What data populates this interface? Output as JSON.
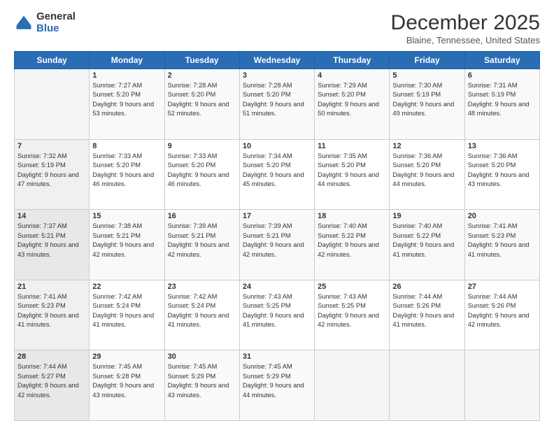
{
  "logo": {
    "general": "General",
    "blue": "Blue"
  },
  "title": "December 2025",
  "subtitle": "Blaine, Tennessee, United States",
  "days_header": [
    "Sunday",
    "Monday",
    "Tuesday",
    "Wednesday",
    "Thursday",
    "Friday",
    "Saturday"
  ],
  "weeks": [
    [
      {
        "day": "",
        "sunrise": "",
        "sunset": "",
        "daylight": ""
      },
      {
        "day": "1",
        "sunrise": "Sunrise: 7:27 AM",
        "sunset": "Sunset: 5:20 PM",
        "daylight": "Daylight: 9 hours and 53 minutes."
      },
      {
        "day": "2",
        "sunrise": "Sunrise: 7:28 AM",
        "sunset": "Sunset: 5:20 PM",
        "daylight": "Daylight: 9 hours and 52 minutes."
      },
      {
        "day": "3",
        "sunrise": "Sunrise: 7:28 AM",
        "sunset": "Sunset: 5:20 PM",
        "daylight": "Daylight: 9 hours and 51 minutes."
      },
      {
        "day": "4",
        "sunrise": "Sunrise: 7:29 AM",
        "sunset": "Sunset: 5:20 PM",
        "daylight": "Daylight: 9 hours and 50 minutes."
      },
      {
        "day": "5",
        "sunrise": "Sunrise: 7:30 AM",
        "sunset": "Sunset: 5:19 PM",
        "daylight": "Daylight: 9 hours and 49 minutes."
      },
      {
        "day": "6",
        "sunrise": "Sunrise: 7:31 AM",
        "sunset": "Sunset: 5:19 PM",
        "daylight": "Daylight: 9 hours and 48 minutes."
      }
    ],
    [
      {
        "day": "7",
        "sunrise": "Sunrise: 7:32 AM",
        "sunset": "Sunset: 5:19 PM",
        "daylight": "Daylight: 9 hours and 47 minutes."
      },
      {
        "day": "8",
        "sunrise": "Sunrise: 7:33 AM",
        "sunset": "Sunset: 5:20 PM",
        "daylight": "Daylight: 9 hours and 46 minutes."
      },
      {
        "day": "9",
        "sunrise": "Sunrise: 7:33 AM",
        "sunset": "Sunset: 5:20 PM",
        "daylight": "Daylight: 9 hours and 46 minutes."
      },
      {
        "day": "10",
        "sunrise": "Sunrise: 7:34 AM",
        "sunset": "Sunset: 5:20 PM",
        "daylight": "Daylight: 9 hours and 45 minutes."
      },
      {
        "day": "11",
        "sunrise": "Sunrise: 7:35 AM",
        "sunset": "Sunset: 5:20 PM",
        "daylight": "Daylight: 9 hours and 44 minutes."
      },
      {
        "day": "12",
        "sunrise": "Sunrise: 7:36 AM",
        "sunset": "Sunset: 5:20 PM",
        "daylight": "Daylight: 9 hours and 44 minutes."
      },
      {
        "day": "13",
        "sunrise": "Sunrise: 7:36 AM",
        "sunset": "Sunset: 5:20 PM",
        "daylight": "Daylight: 9 hours and 43 minutes."
      }
    ],
    [
      {
        "day": "14",
        "sunrise": "Sunrise: 7:37 AM",
        "sunset": "Sunset: 5:21 PM",
        "daylight": "Daylight: 9 hours and 43 minutes."
      },
      {
        "day": "15",
        "sunrise": "Sunrise: 7:38 AM",
        "sunset": "Sunset: 5:21 PM",
        "daylight": "Daylight: 9 hours and 42 minutes."
      },
      {
        "day": "16",
        "sunrise": "Sunrise: 7:39 AM",
        "sunset": "Sunset: 5:21 PM",
        "daylight": "Daylight: 9 hours and 42 minutes."
      },
      {
        "day": "17",
        "sunrise": "Sunrise: 7:39 AM",
        "sunset": "Sunset: 5:21 PM",
        "daylight": "Daylight: 9 hours and 42 minutes."
      },
      {
        "day": "18",
        "sunrise": "Sunrise: 7:40 AM",
        "sunset": "Sunset: 5:22 PM",
        "daylight": "Daylight: 9 hours and 42 minutes."
      },
      {
        "day": "19",
        "sunrise": "Sunrise: 7:40 AM",
        "sunset": "Sunset: 5:22 PM",
        "daylight": "Daylight: 9 hours and 41 minutes."
      },
      {
        "day": "20",
        "sunrise": "Sunrise: 7:41 AM",
        "sunset": "Sunset: 5:23 PM",
        "daylight": "Daylight: 9 hours and 41 minutes."
      }
    ],
    [
      {
        "day": "21",
        "sunrise": "Sunrise: 7:41 AM",
        "sunset": "Sunset: 5:23 PM",
        "daylight": "Daylight: 9 hours and 41 minutes."
      },
      {
        "day": "22",
        "sunrise": "Sunrise: 7:42 AM",
        "sunset": "Sunset: 5:24 PM",
        "daylight": "Daylight: 9 hours and 41 minutes."
      },
      {
        "day": "23",
        "sunrise": "Sunrise: 7:42 AM",
        "sunset": "Sunset: 5:24 PM",
        "daylight": "Daylight: 9 hours and 41 minutes."
      },
      {
        "day": "24",
        "sunrise": "Sunrise: 7:43 AM",
        "sunset": "Sunset: 5:25 PM",
        "daylight": "Daylight: 9 hours and 41 minutes."
      },
      {
        "day": "25",
        "sunrise": "Sunrise: 7:43 AM",
        "sunset": "Sunset: 5:25 PM",
        "daylight": "Daylight: 9 hours and 42 minutes."
      },
      {
        "day": "26",
        "sunrise": "Sunrise: 7:44 AM",
        "sunset": "Sunset: 5:26 PM",
        "daylight": "Daylight: 9 hours and 41 minutes."
      },
      {
        "day": "27",
        "sunrise": "Sunrise: 7:44 AM",
        "sunset": "Sunset: 5:26 PM",
        "daylight": "Daylight: 9 hours and 42 minutes."
      }
    ],
    [
      {
        "day": "28",
        "sunrise": "Sunrise: 7:44 AM",
        "sunset": "Sunset: 5:27 PM",
        "daylight": "Daylight: 9 hours and 42 minutes."
      },
      {
        "day": "29",
        "sunrise": "Sunrise: 7:45 AM",
        "sunset": "Sunset: 5:28 PM",
        "daylight": "Daylight: 9 hours and 43 minutes."
      },
      {
        "day": "30",
        "sunrise": "Sunrise: 7:45 AM",
        "sunset": "Sunset: 5:29 PM",
        "daylight": "Daylight: 9 hours and 43 minutes."
      },
      {
        "day": "31",
        "sunrise": "Sunrise: 7:45 AM",
        "sunset": "Sunset: 5:29 PM",
        "daylight": "Daylight: 9 hours and 44 minutes."
      },
      {
        "day": "",
        "sunrise": "",
        "sunset": "",
        "daylight": ""
      },
      {
        "day": "",
        "sunrise": "",
        "sunset": "",
        "daylight": ""
      },
      {
        "day": "",
        "sunrise": "",
        "sunset": "",
        "daylight": ""
      }
    ]
  ]
}
